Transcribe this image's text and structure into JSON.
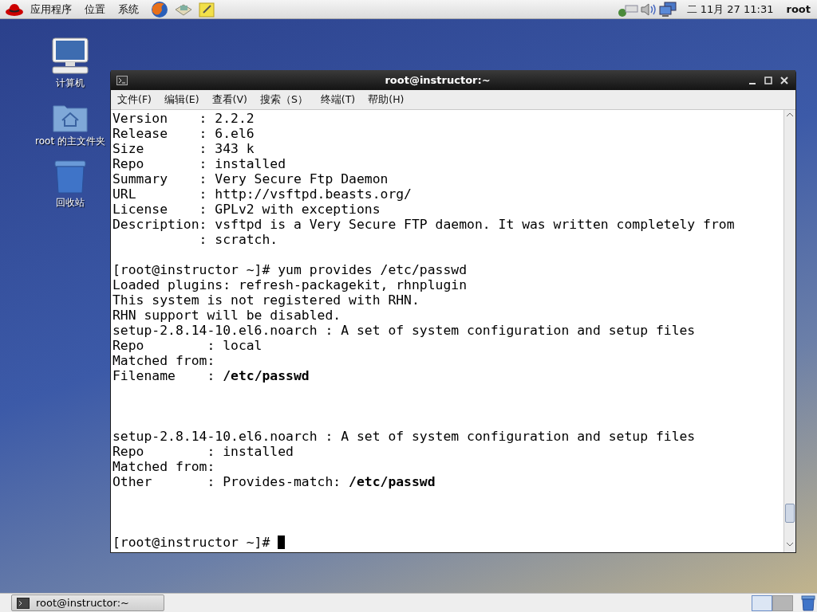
{
  "top_panel": {
    "menus": [
      "应用程序",
      "位置",
      "系统"
    ],
    "clock": "二 11月 27 11:31",
    "user": "root"
  },
  "desktop_icons": [
    {
      "kind": "computer",
      "label": "计算机"
    },
    {
      "kind": "home",
      "label": "root 的主文件夹"
    },
    {
      "kind": "trash",
      "label": "回收站"
    }
  ],
  "window": {
    "title": "root@instructor:~",
    "menu": [
      "文件(F)",
      "编辑(E)",
      "查看(V)",
      "搜索（S）",
      "终端(T)",
      "帮助(H)"
    ],
    "lines": [
      {
        "kind": "text",
        "text": "Version    : 2.2.2"
      },
      {
        "kind": "text",
        "text": "Release    : 6.el6"
      },
      {
        "kind": "text",
        "text": "Size       : 343 k"
      },
      {
        "kind": "text",
        "text": "Repo       : installed"
      },
      {
        "kind": "text",
        "text": "Summary    : Very Secure Ftp Daemon"
      },
      {
        "kind": "text",
        "text": "URL        : http://vsftpd.beasts.org/"
      },
      {
        "kind": "text",
        "text": "License    : GPLv2 with exceptions"
      },
      {
        "kind": "text",
        "text": "Description: vsftpd is a Very Secure FTP daemon. It was written completely from"
      },
      {
        "kind": "text",
        "text": "           : scratch."
      },
      {
        "kind": "blank"
      },
      {
        "kind": "text",
        "text": "[root@instructor ~]# yum provides /etc/passwd"
      },
      {
        "kind": "text",
        "text": "Loaded plugins: refresh-packagekit, rhnplugin"
      },
      {
        "kind": "text",
        "text": "This system is not registered with RHN."
      },
      {
        "kind": "text",
        "text": "RHN support will be disabled."
      },
      {
        "kind": "text",
        "text": "setup-2.8.14-10.el6.noarch : A set of system configuration and setup files"
      },
      {
        "kind": "text",
        "text": "Repo        : local"
      },
      {
        "kind": "text",
        "text": "Matched from:"
      },
      {
        "kind": "text",
        "text": "Filename    : **/etc/passwd**"
      },
      {
        "kind": "blank"
      },
      {
        "kind": "blank"
      },
      {
        "kind": "blank"
      },
      {
        "kind": "text",
        "text": "setup-2.8.14-10.el6.noarch : A set of system configuration and setup files"
      },
      {
        "kind": "text",
        "text": "Repo        : installed"
      },
      {
        "kind": "text",
        "text": "Matched from:"
      },
      {
        "kind": "text",
        "text": "Other       : Provides-match: **/etc/passwd**"
      },
      {
        "kind": "blank"
      },
      {
        "kind": "blank"
      },
      {
        "kind": "blank"
      },
      {
        "kind": "prompt",
        "text": "[root@instructor ~]#"
      }
    ]
  },
  "taskbar": {
    "tasks": [
      {
        "label": "root@instructor:~",
        "selected": false
      }
    ],
    "workspaces": [
      {
        "selected": true
      },
      {
        "selected": false
      }
    ]
  }
}
